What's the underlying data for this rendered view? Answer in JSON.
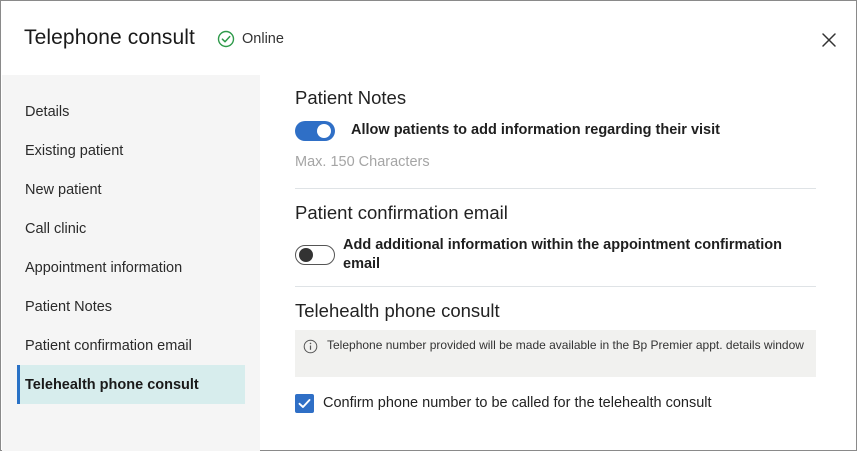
{
  "header": {
    "title": "Telephone consult",
    "status_label": "Online",
    "status_icon": "check-circle-icon",
    "close_icon": "close-icon"
  },
  "sidebar": {
    "items": [
      {
        "label": "Details",
        "active": false
      },
      {
        "label": "Existing patient",
        "active": false
      },
      {
        "label": "New patient",
        "active": false
      },
      {
        "label": "Call clinic",
        "active": false
      },
      {
        "label": "Appointment information",
        "active": false
      },
      {
        "label": "Patient Notes",
        "active": false
      },
      {
        "label": "Patient confirmation email",
        "active": false
      },
      {
        "label": "Telehealth phone consult",
        "active": true
      }
    ]
  },
  "patient_notes": {
    "title": "Patient Notes",
    "toggle_label": "Allow patients to add information regarding their visit",
    "toggle_on": true,
    "max_chars_hint": "Max. 150 Characters"
  },
  "confirmation_email": {
    "title": "Patient confirmation email",
    "toggle_label": "Add additional information within the appointment confirmation email",
    "toggle_on": false
  },
  "telehealth": {
    "title": "Telehealth phone consult",
    "info_icon": "info-icon",
    "info_text": "Telephone number provided will be made available in the Bp Premier appt. details window",
    "checkbox_label": "Confirm phone number to be called for the telehealth consult",
    "checkbox_checked": true
  },
  "colors": {
    "accent": "#2f6fc6",
    "status_green": "#2e9a4a",
    "sidebar_bg": "#f5f5f5",
    "active_item_bg": "#d7eded",
    "hint_text": "#a5a5a5"
  }
}
